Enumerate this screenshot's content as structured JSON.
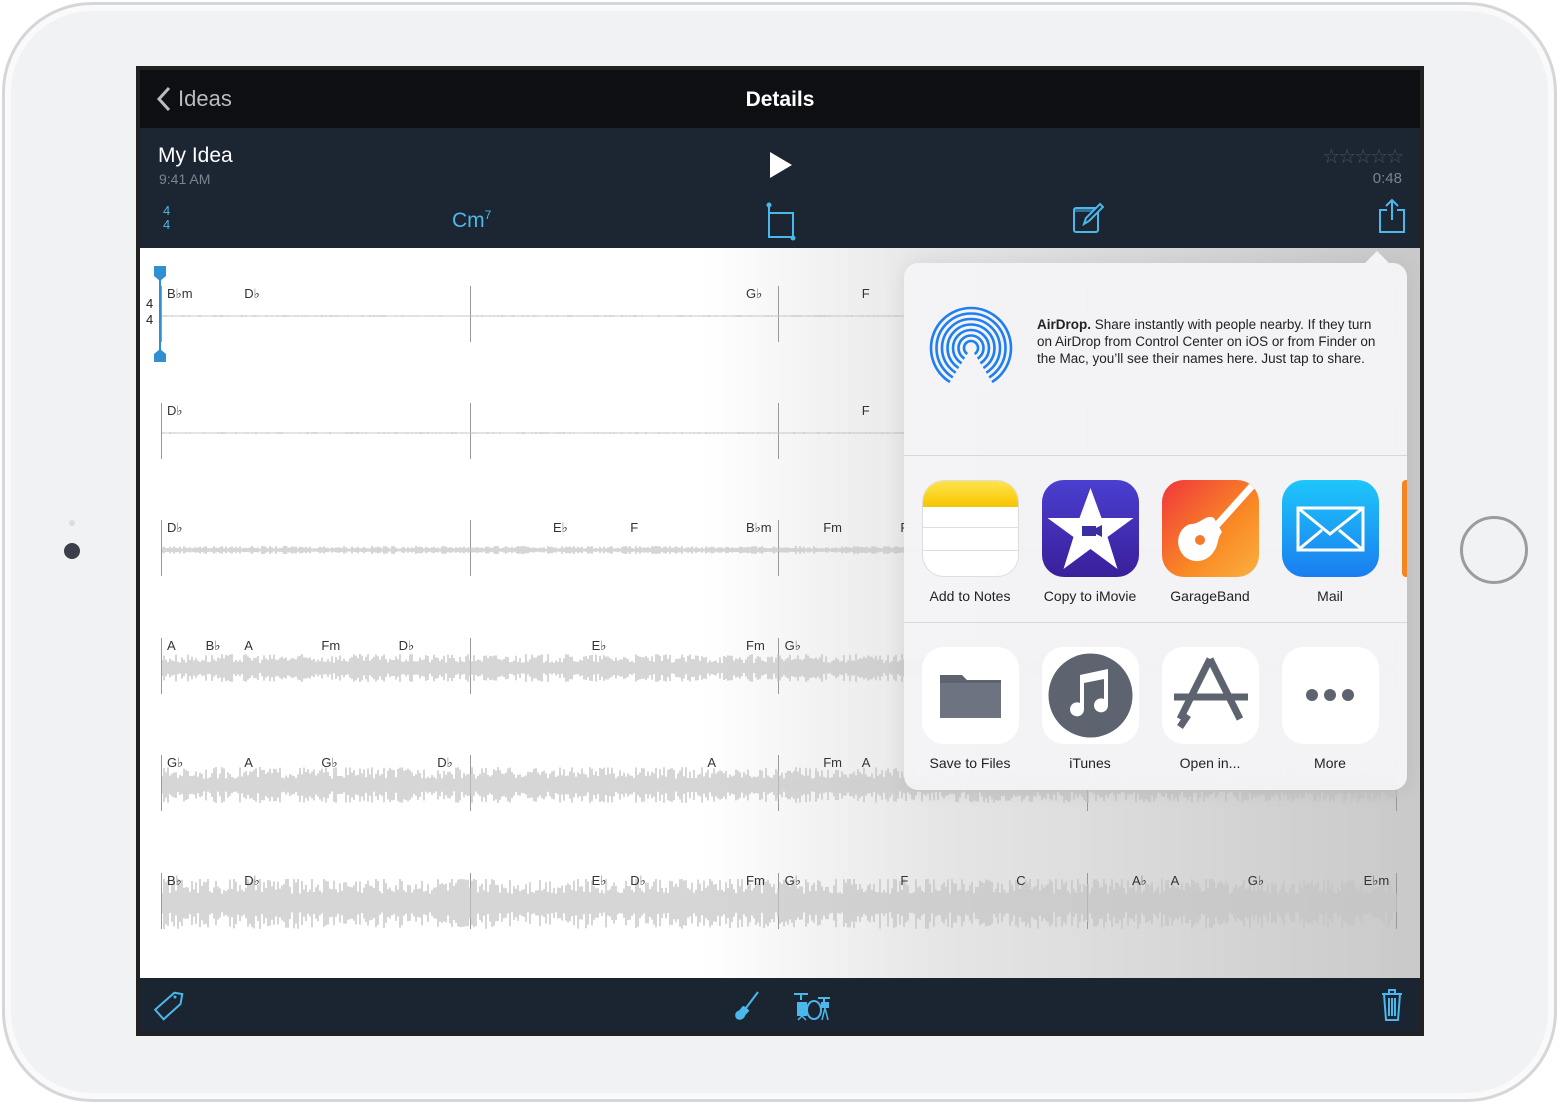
{
  "nav": {
    "back_label": "Ideas",
    "title": "Details"
  },
  "idea": {
    "name": "My Idea",
    "time": "9:41 AM",
    "rating": 0,
    "rating_max": 5,
    "stars": "☆☆☆☆☆",
    "duration": "0:48",
    "time_sig_top": "4",
    "time_sig_bottom": "4",
    "key_chord": "Cm",
    "key_chord_ext": "7"
  },
  "track": {
    "time_sig_top": "4",
    "time_sig_bottom": "4",
    "rows": [
      [
        {
          "label": "B♭m",
          "beat": 0
        },
        {
          "label": "D♭",
          "beat": 2
        },
        {
          "label": "G♭",
          "beat": 15
        },
        {
          "label": "F",
          "beat": 18
        }
      ],
      [
        {
          "label": "D♭",
          "beat": 0
        },
        {
          "label": "F",
          "beat": 18
        }
      ],
      [
        {
          "label": "D♭",
          "beat": 0
        },
        {
          "label": "E♭",
          "beat": 10
        },
        {
          "label": "F",
          "beat": 12
        },
        {
          "label": "B♭m",
          "beat": 15
        },
        {
          "label": "Fm",
          "beat": 17
        },
        {
          "label": "F",
          "beat": 19
        }
      ],
      [
        {
          "label": "A",
          "beat": 0
        },
        {
          "label": "B♭",
          "beat": 1
        },
        {
          "label": "A",
          "beat": 2
        },
        {
          "label": "Fm",
          "beat": 4
        },
        {
          "label": "D♭",
          "beat": 6
        },
        {
          "label": "E♭",
          "beat": 11
        },
        {
          "label": "Fm",
          "beat": 15
        },
        {
          "label": "G♭",
          "beat": 16
        }
      ],
      [
        {
          "label": "G♭",
          "beat": 0
        },
        {
          "label": "A",
          "beat": 2
        },
        {
          "label": "G♭",
          "beat": 4
        },
        {
          "label": "D♭",
          "beat": 7
        },
        {
          "label": "A",
          "beat": 14
        },
        {
          "label": "Fm",
          "beat": 17
        },
        {
          "label": "A",
          "beat": 18
        }
      ],
      [
        {
          "label": "B♭",
          "beat": 0
        },
        {
          "label": "D♭",
          "beat": 2
        },
        {
          "label": "E♭",
          "beat": 11
        },
        {
          "label": "D♭",
          "beat": 12
        },
        {
          "label": "Fm",
          "beat": 15
        },
        {
          "label": "G♭",
          "beat": 16
        },
        {
          "label": "F",
          "beat": 19
        },
        {
          "label": "C",
          "beat": 22
        },
        {
          "label": "A♭",
          "beat": 25
        },
        {
          "label": "A",
          "beat": 26
        },
        {
          "label": "G♭",
          "beat": 28
        },
        {
          "label": "E♭m",
          "beat": 31
        }
      ]
    ]
  },
  "share": {
    "airdrop_title": "AirDrop.",
    "airdrop_text": " Share instantly with people nearby. If they turn on AirDrop from Control Center on iOS or from Finder on the Mac, you’ll see their names here. Just tap to share.",
    "apps": [
      {
        "label": "Add to Notes",
        "icon": "notes-icon"
      },
      {
        "label": "Copy to iMovie",
        "icon": "imovie-icon"
      },
      {
        "label": "GarageBand",
        "icon": "garageband-icon"
      },
      {
        "label": "Mail",
        "icon": "mail-icon"
      }
    ],
    "actions": [
      {
        "label": "Save to Files",
        "icon": "folder-icon"
      },
      {
        "label": "iTunes",
        "icon": "itunes-icon"
      },
      {
        "label": "Open in...",
        "icon": "app-store-icon"
      },
      {
        "label": "More",
        "icon": "more-icon"
      }
    ]
  },
  "colors": {
    "accent": "#4ab8ea",
    "toolbar": "#1b2431",
    "navbar": "#0d0f12"
  }
}
